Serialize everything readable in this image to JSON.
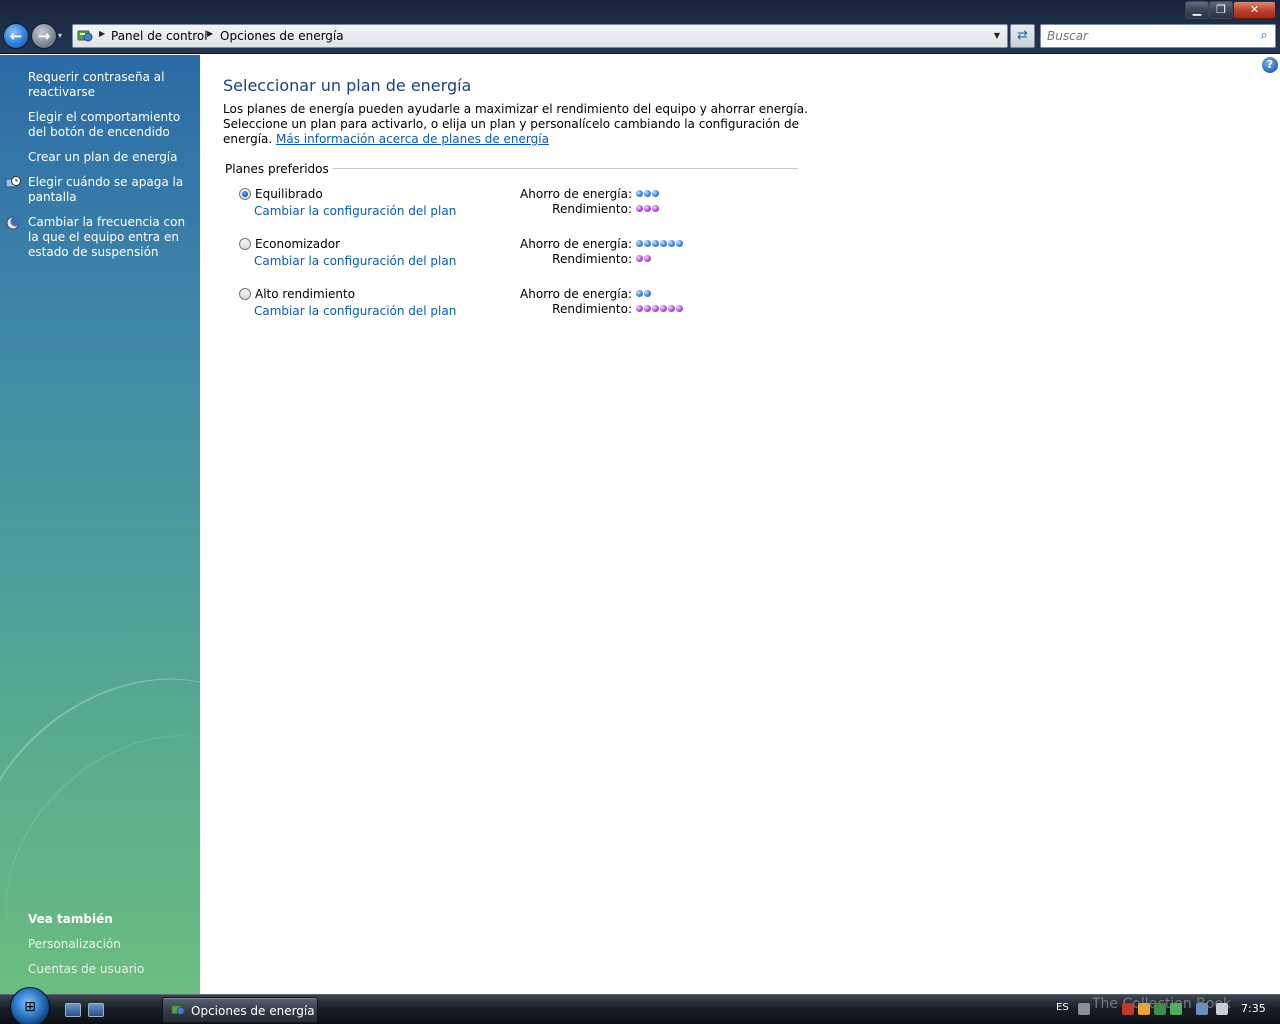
{
  "window": {
    "minimize_label": "▁",
    "maximize_label": "❐",
    "close_label": "✕"
  },
  "nav": {
    "back_label": "←",
    "forward_label": "→",
    "recent_label": "▾",
    "breadcrumb": [
      "Panel de control",
      "Opciones de energía"
    ],
    "refresh_label": "⇄",
    "search_placeholder": "Buscar",
    "search_icon": "search-icon"
  },
  "sidebar": {
    "tasks": [
      {
        "label": "Requerir contraseña al reactivarse",
        "icon": null
      },
      {
        "label": "Elegir el comportamiento del botón de encendido",
        "icon": null
      },
      {
        "label": "Crear un plan de energía",
        "icon": null
      },
      {
        "label": "Elegir cuándo se apaga la pantalla",
        "icon": "display-clock-icon"
      },
      {
        "label": "Cambiar la frecuencia con la que el equipo entra en estado de suspensión",
        "icon": "moon-icon"
      }
    ],
    "see_also_title": "Vea también",
    "see_also": [
      "Personalización",
      "Cuentas de usuario"
    ]
  },
  "main": {
    "title": "Seleccionar un plan de energía",
    "intro_text": "Los planes de energía pueden ayudarle a maximizar el rendimiento del equipo y ahorrar energía. Seleccione un plan para activarlo, o elija un plan y personalícelo cambiando la configuración de energía. ",
    "intro_link": "Más información acerca de planes de energía",
    "group_label": "Planes preferidos",
    "saving_label": "Ahorro de energía:",
    "performance_label": "Rendimiento:",
    "change_link": "Cambiar la configuración del plan",
    "plans": [
      {
        "name": "Equilibrado",
        "selected": true,
        "saving": 3,
        "performance": 3
      },
      {
        "name": "Economizador",
        "selected": false,
        "saving": 6,
        "performance": 2
      },
      {
        "name": "Alto rendimiento",
        "selected": false,
        "saving": 2,
        "performance": 6
      }
    ],
    "help_label": "?"
  },
  "taskbar": {
    "start_label": "⊞",
    "active_window": "Opciones de energía",
    "language": "ES",
    "watermark": "The Collection Book",
    "clock": "7:35"
  },
  "colors": {
    "saving_dot": "#3c7fe0",
    "performance_dot": "#b24fd6",
    "link": "#0b5ab3",
    "title": "#1e3e8a"
  }
}
